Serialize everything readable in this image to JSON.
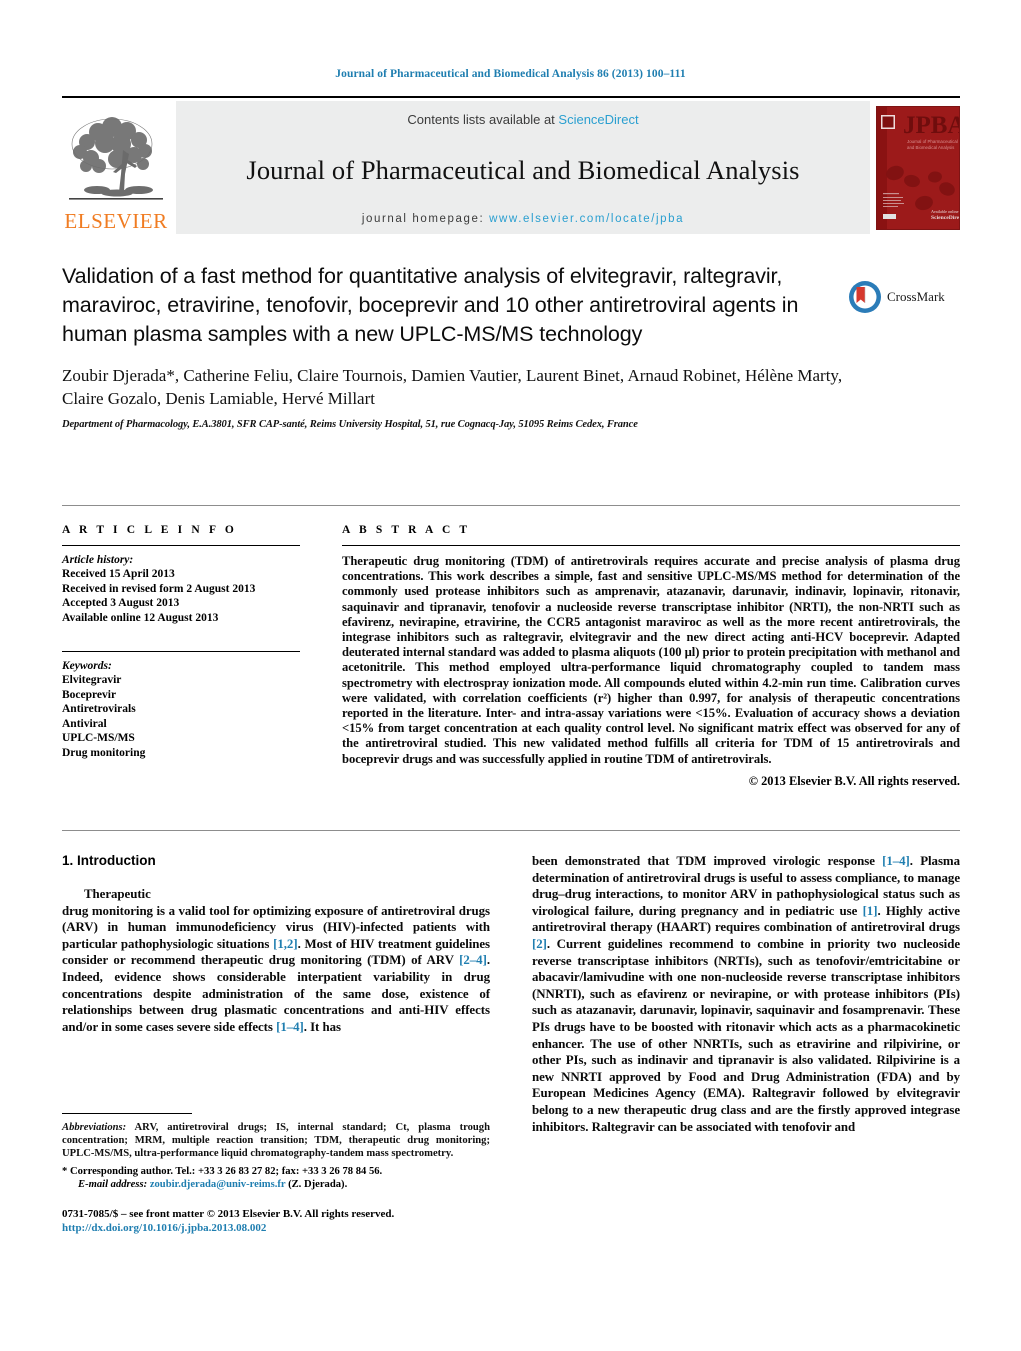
{
  "running_head": "Journal of Pharmaceutical and Biomedical Analysis 86 (2013) 100–111",
  "masthead": {
    "contents_prefix": "Contents lists available at ",
    "sciencedirect": "ScienceDirect",
    "journal_title": "Journal of Pharmaceutical and Biomedical Analysis",
    "homepage_label": "journal homepage:",
    "homepage_url": "www.elsevier.com/locate/jpba",
    "elsevier_wordmark": "ELSEVIER",
    "cover_acronym": "JPBA",
    "cover_subtitle": "Journal of Pharmaceutical and Biomedical Analysis",
    "accent_blue": "#2a9fd0",
    "elsevier_orange": "#f07c22",
    "cover_red": "#9d1b1b"
  },
  "title_block": {
    "title": "Validation of a fast method for quantitative analysis of elvitegravir, raltegravir, maraviroc, etravirine, tenofovir, boceprevir and 10 other antiretroviral agents in human plasma samples with a new UPLC-MS/MS technology",
    "crossmark_label": "CrossMark",
    "authors": "Zoubir Djerada*, Catherine Feliu, Claire Tournois, Damien Vautier, Laurent Binet, Arnaud Robinet, Hélène Marty, Claire Gozalo, Denis Lamiable, Hervé Millart",
    "affiliation": "Department of Pharmacology, E.A.3801, SFR CAP-santé, Reims University Hospital, 51, rue Cognacq-Jay, 51095 Reims Cedex, France"
  },
  "article_info": {
    "heading": "A R T I C L E    I N F O",
    "history_label": "Article history:",
    "history": [
      "Received 15 April 2013",
      "Received in revised form 2 August 2013",
      "Accepted 3 August 2013",
      "Available online 12 August 2013"
    ],
    "keywords_label": "Keywords:",
    "keywords": [
      "Elvitegravir",
      "Boceprevir",
      "Antiretrovirals",
      "Antiviral",
      "UPLC-MS/MS",
      "Drug monitoring"
    ]
  },
  "abstract": {
    "heading": "A B S T R A C T",
    "body": "Therapeutic drug monitoring (TDM) of antiretrovirals requires accurate and precise analysis of plasma drug concentrations. This work describes a simple, fast and sensitive UPLC-MS/MS method for determination of the commonly used protease inhibitors such as amprenavir, atazanavir, darunavir, indinavir, lopinavir, ritonavir, saquinavir and tipranavir, tenofovir a nucleoside reverse transcriptase inhibitor (NRTI), the non-NRTI such as efavirenz, nevirapine, etravirine, the CCR5 antagonist maraviroc as well as the more recent antiretrovirals, the integrase inhibitors such as raltegravir, elvitegravir and the new direct acting anti-HCV boceprevir. Adapted deuterated internal standard was added to plasma aliquots (100 µl) prior to protein precipitation with methanol and acetonitrile. This method employed ultra-performance liquid chromatography coupled to tandem mass spectrometry with electrospray ionization mode. All compounds eluted within 4.2-min run time. Calibration curves were validated, with correlation coefficients (r²) higher than 0.997, for analysis of therapeutic concentrations reported in the literature. Inter- and intra-assay variations were <15%. Evaluation of accuracy shows a deviation <15% from target concentration at each quality control level. No significant matrix effect was observed for any of the antiretroviral studied. This new validated method fulfills all criteria for TDM of 15 antiretrovirals and boceprevir drugs and was successfully applied in routine TDM of antiretrovirals.",
    "copyright": "© 2013 Elsevier B.V. All rights reserved."
  },
  "introduction": {
    "section_number_title": "1.  Introduction",
    "left_paragraph_pre": "Therapeutic",
    "left_paragraph": "drug monitoring is a valid tool for optimizing exposure of antiretroviral drugs (ARV) in human immunodeficiency virus (HIV)-infected patients with particular pathophysiologic situations [1,2]. Most of HIV treatment guidelines consider or recommend therapeutic drug monitoring (TDM) of ARV [2–4]. Indeed, evidence shows considerable interpatient variability in drug concentrations despite administration of the same dose, existence of relationships between drug plasmatic concentrations and anti-HIV effects and/or in some cases severe side effects [1–4]. It has",
    "right_paragraph": "been demonstrated that TDM improved virologic response [1–4]. Plasma determination of antiretroviral drugs is useful to assess compliance, to manage drug–drug interactions, to monitor ARV in pathophysiological status such as virological failure, during pregnancy and in pediatric use [1]. Highly active antiretroviral therapy (HAART) requires combination of antiretroviral drugs [2]. Current guidelines recommend to combine in priority two nucleoside reverse transcriptase inhibitors (NRTIs), such as tenofovir/emtricitabine or abacavir/lamivudine with one non-nucleoside reverse transcriptase inhibitors (NNRTI), such as efavirenz or nevirapine, or with protease inhibitors (PIs) such as atazanavir, darunavir, lopinavir, saquinavir and fosamprenavir. These PIs drugs have to be boosted with ritonavir which acts as a pharmacokinetic enhancer. The use of other NNRTIs, such as etravirine and rilpivirine, or other PIs, such as indinavir and tipranavir is also validated. Rilpivirine is a new NNRTI approved by Food and Drug Administration (FDA) and by European Medicines Agency (EMA). Raltegravir followed by elvitegravir belong to a new therapeutic drug class and are the firstly approved integrase inhibitors. Raltegravir can be associated with tenofovir and"
  },
  "footnotes": {
    "abbrev_label": "Abbreviations:",
    "abbrev_text": "ARV, antiretroviral drugs; IS, internal standard; Ct, plasma trough concentration; MRM, multiple reaction transition; TDM, therapeutic drug monitoring; UPLC-MS/MS, ultra-performance liquid chromatography-tandem mass spectrometry.",
    "corresponding": "* Corresponding author. Tel.: +33 3 26 83 27 82; fax: +33 3 26 78 84 56.",
    "email_label": "E-mail address:",
    "email": "zoubir.djerada@univ-reims.fr",
    "email_suffix": "(Z. Djerada).",
    "issn_line": "0731-7085/$ – see front matter © 2013 Elsevier B.V. All rights reserved.",
    "doi": "http://dx.doi.org/10.1016/j.jpba.2013.08.002"
  }
}
